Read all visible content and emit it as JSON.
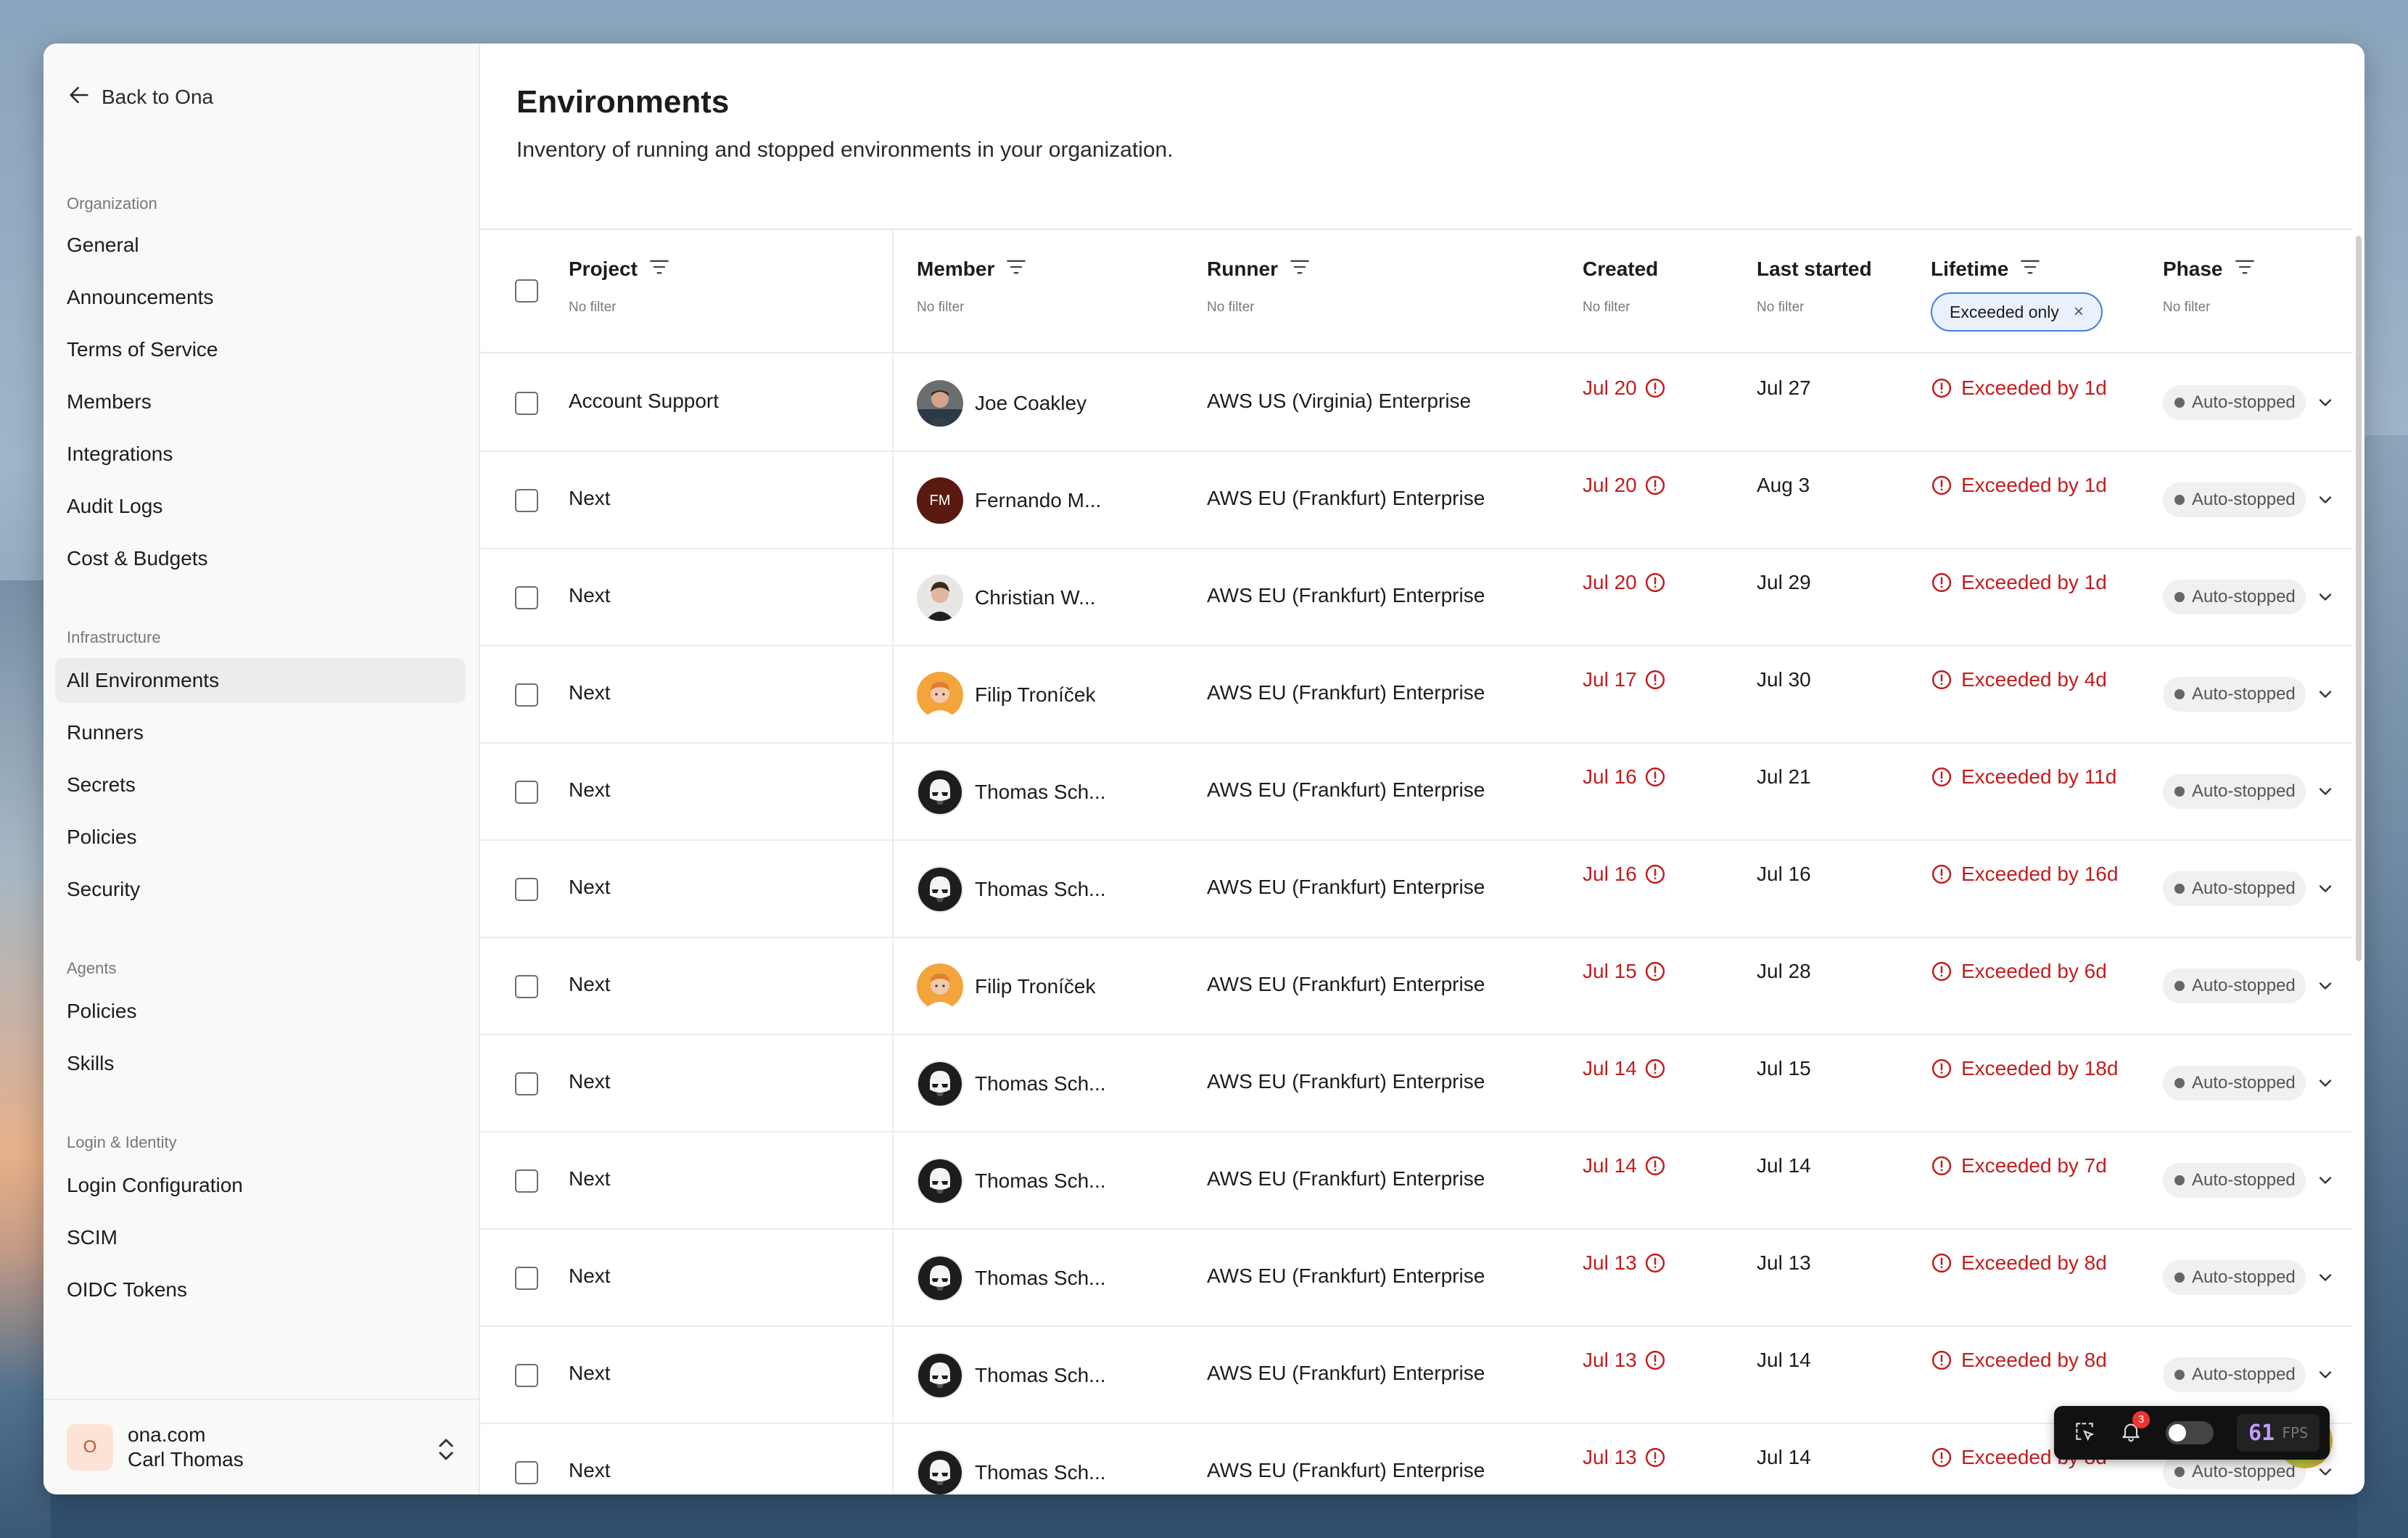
{
  "sidebar": {
    "back_label": "Back to Ona",
    "sections": [
      {
        "label": "Organization",
        "items": [
          "General",
          "Announcements",
          "Terms of Service",
          "Members",
          "Integrations",
          "Audit Logs",
          "Cost & Budgets"
        ]
      },
      {
        "label": "Infrastructure",
        "items": [
          "All Environments",
          "Runners",
          "Secrets",
          "Policies",
          "Security"
        ]
      },
      {
        "label": "Agents",
        "items": [
          "Policies",
          "Skills"
        ]
      },
      {
        "label": "Login & Identity",
        "items": [
          "Login Configuration",
          "SCIM",
          "OIDC Tokens"
        ]
      }
    ],
    "active_item": "All Environments",
    "account": {
      "initial": "O",
      "org": "ona.com",
      "user": "Carl Thomas"
    }
  },
  "page": {
    "title": "Environments",
    "subtitle": "Inventory of running and stopped environments in your organization."
  },
  "table": {
    "headers": {
      "project": {
        "label": "Project",
        "sub": "No filter"
      },
      "member": {
        "label": "Member",
        "sub": "No filter"
      },
      "runner": {
        "label": "Runner",
        "sub": "No filter"
      },
      "created": {
        "label": "Created",
        "sub": "No filter"
      },
      "last_started": {
        "label": "Last started",
        "sub": "No filter"
      },
      "lifetime": {
        "label": "Lifetime",
        "chip": "Exceeded only",
        "chip_close": "×"
      },
      "phase": {
        "label": "Phase",
        "sub": "No filter"
      }
    },
    "rows": [
      {
        "project": "Account Support",
        "member": "Joe Coakley",
        "avatar": "photo-dark",
        "runner": "AWS US (Virginia) Enterprise",
        "created": "Jul 20",
        "last_started": "Jul 27",
        "lifetime": "Exceeded by 1d",
        "phase": "Auto-stopped"
      },
      {
        "project": "Next",
        "member": "Fernando M...",
        "avatar": "FM",
        "runner": "AWS EU (Frankfurt) Enterprise",
        "created": "Jul 20",
        "last_started": "Aug 3",
        "lifetime": "Exceeded by 1d",
        "phase": "Auto-stopped"
      },
      {
        "project": "Next",
        "member": "Christian W...",
        "avatar": "photo-light",
        "runner": "AWS EU (Frankfurt) Enterprise",
        "created": "Jul 20",
        "last_started": "Jul 29",
        "lifetime": "Exceeded by 1d",
        "phase": "Auto-stopped"
      },
      {
        "project": "Next",
        "member": "Filip Troníček",
        "avatar": "cartoon",
        "runner": "AWS EU (Frankfurt) Enterprise",
        "created": "Jul 17",
        "last_started": "Jul 30",
        "lifetime": "Exceeded by 4d",
        "phase": "Auto-stopped"
      },
      {
        "project": "Next",
        "member": "Thomas Sch...",
        "avatar": "trooper",
        "runner": "AWS EU (Frankfurt) Enterprise",
        "created": "Jul 16",
        "last_started": "Jul 21",
        "lifetime": "Exceeded by 11d",
        "phase": "Auto-stopped"
      },
      {
        "project": "Next",
        "member": "Thomas Sch...",
        "avatar": "trooper",
        "runner": "AWS EU (Frankfurt) Enterprise",
        "created": "Jul 16",
        "last_started": "Jul 16",
        "lifetime": "Exceeded by 16d",
        "phase": "Auto-stopped"
      },
      {
        "project": "Next",
        "member": "Filip Troníček",
        "avatar": "cartoon",
        "runner": "AWS EU (Frankfurt) Enterprise",
        "created": "Jul 15",
        "last_started": "Jul 28",
        "lifetime": "Exceeded by 6d",
        "phase": "Auto-stopped"
      },
      {
        "project": "Next",
        "member": "Thomas Sch...",
        "avatar": "trooper",
        "runner": "AWS EU (Frankfurt) Enterprise",
        "created": "Jul 14",
        "last_started": "Jul 15",
        "lifetime": "Exceeded by 18d",
        "phase": "Auto-stopped"
      },
      {
        "project": "Next",
        "member": "Thomas Sch...",
        "avatar": "trooper",
        "runner": "AWS EU (Frankfurt) Enterprise",
        "created": "Jul 14",
        "last_started": "Jul 14",
        "lifetime": "Exceeded by 7d",
        "phase": "Auto-stopped"
      },
      {
        "project": "Next",
        "member": "Thomas Sch...",
        "avatar": "trooper",
        "runner": "AWS EU (Frankfurt) Enterprise",
        "created": "Jul 13",
        "last_started": "Jul 13",
        "lifetime": "Exceeded by 8d",
        "phase": "Auto-stopped"
      },
      {
        "project": "Next",
        "member": "Thomas Sch...",
        "avatar": "trooper",
        "runner": "AWS EU (Frankfurt) Enterprise",
        "created": "Jul 13",
        "last_started": "Jul 14",
        "lifetime": "Exceeded by 8d",
        "phase": "Auto-stopped"
      },
      {
        "project": "Next",
        "member": "Thomas Sch...",
        "avatar": "trooper",
        "runner": "AWS EU (Frankfurt) Enterprise",
        "created": "Jul 13",
        "last_started": "Jul 14",
        "lifetime": "Exceeded by 8d",
        "phase": "Auto-stopped"
      }
    ]
  },
  "devbar": {
    "notifications": "3",
    "fps_value": "61",
    "fps_label": "FPS"
  },
  "colors": {
    "danger": "#c21d1d",
    "chip_border": "#3f7fe0",
    "chip_bg": "#eaf1fd",
    "active_nav": "#ececea"
  }
}
